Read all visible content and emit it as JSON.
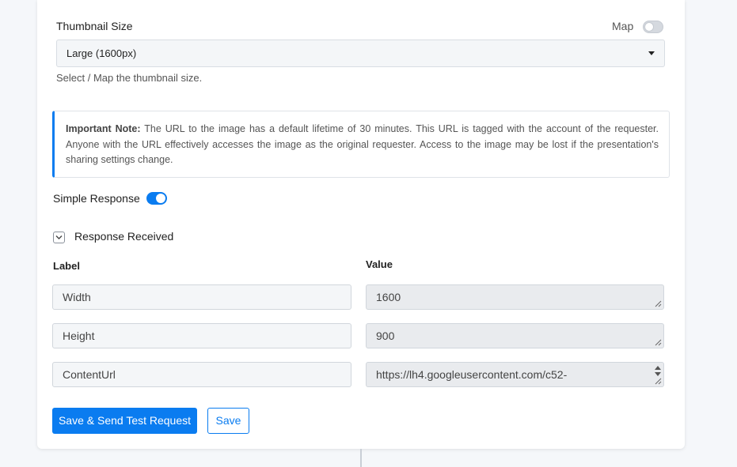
{
  "thumbnail": {
    "label": "Thumbnail Size",
    "map_label": "Map",
    "map_enabled": false,
    "selected": "Large (1600px)",
    "helper": "Select / Map the thumbnail size."
  },
  "note": {
    "title": "Important Note:",
    "body": " The URL to the image has a default lifetime of 30 minutes. This URL is tagged with the account of the requester. Anyone with the URL effectively accesses the image as the original requester. Access to the image may be lost if the presentation's sharing settings change."
  },
  "simple_response": {
    "label": "Simple Response",
    "enabled": true
  },
  "response": {
    "label": "Response Received",
    "col_label": "Label",
    "col_value": "Value",
    "rows": [
      {
        "label": "Width",
        "value": "1600"
      },
      {
        "label": "Height",
        "value": "900"
      },
      {
        "label": "ContentUrl",
        "value": "https://lh4.googleusercontent.com/c52-"
      }
    ]
  },
  "actions": {
    "save_send_label": "Save & Send Test Request",
    "save_label": "Save"
  },
  "colors": {
    "accent": "#0a7cf0"
  }
}
